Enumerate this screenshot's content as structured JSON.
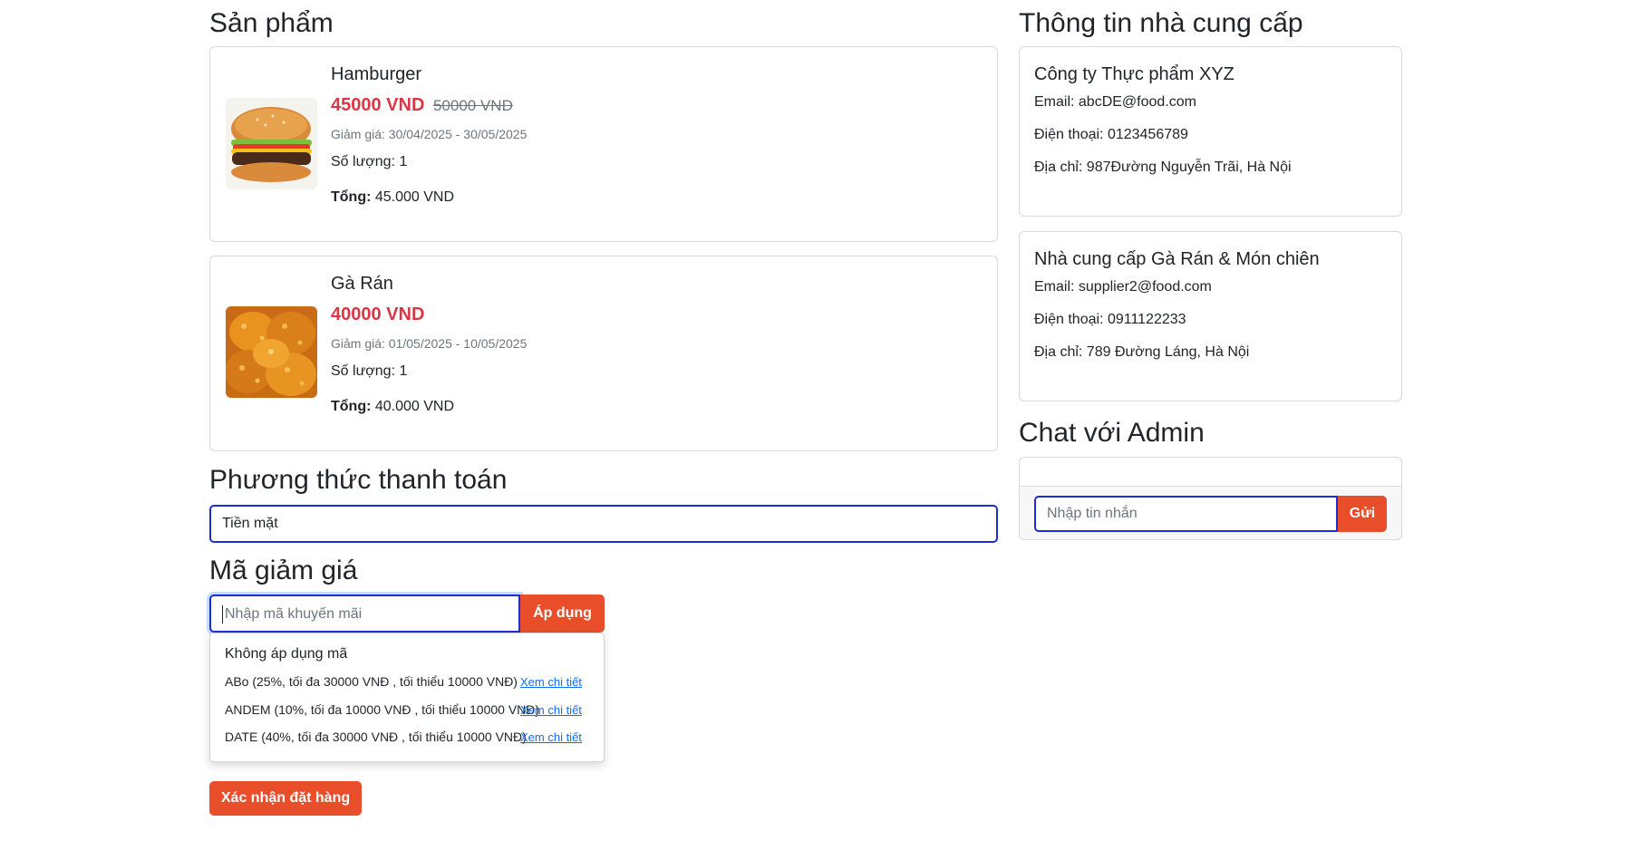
{
  "products_section": {
    "heading": "Sản phẩm",
    "items": [
      {
        "name": "Hamburger",
        "price": "45000 VND",
        "old_price": "50000 VND",
        "discount_period": "Giảm giá: 30/04/2025 - 30/05/2025",
        "quantity": "Số lượng: 1",
        "total_label": "Tổng:",
        "total_value": "45.000 VND",
        "image_icon": "hamburger-image"
      },
      {
        "name": "Gà Rán",
        "price": "40000 VND",
        "old_price": "",
        "discount_period": "Giảm giá: 01/05/2025 - 10/05/2025",
        "quantity": "Số lượng: 1",
        "total_label": "Tổng:",
        "total_value": "40.000 VND",
        "image_icon": "fried-chicken-image"
      }
    ]
  },
  "payment": {
    "heading": "Phương thức thanh toán",
    "selected": "Tiền mặt"
  },
  "coupon": {
    "heading": "Mã giảm giá",
    "placeholder": "Nhập mã khuyến mãi",
    "apply_label": "Áp dụng",
    "none_option": "Không áp dụng mã",
    "options": [
      {
        "text": "ABo (25%, tối đa 30000 VNĐ , tối thiểu 10000 VNĐ)",
        "link": "Xem chi tiết"
      },
      {
        "text": "ANDEM (10%, tối đa 10000 VNĐ , tối thiểu 10000 VNĐ)",
        "link": "Xem chi tiết"
      },
      {
        "text": "DATE (40%, tối đa 30000 VNĐ , tối thiểu 10000 VNĐ)",
        "link": "Xem chi tiết"
      }
    ]
  },
  "confirm_label": "Xác nhận đặt hàng",
  "suppliers_section": {
    "heading": "Thông tin nhà cung cấp",
    "items": [
      {
        "name": "Công ty Thực phẩm XYZ",
        "email": "Email: abcDE@food.com",
        "phone": "Điện thoại: 0123456789",
        "address": "Địa chỉ: 987Đường Nguyễn Trãi, Hà Nội"
      },
      {
        "name": "Nhà cung cấp Gà Rán & Món chiên",
        "email": "Email: supplier2@food.com",
        "phone": "Điện thoại: 0911122233",
        "address": "Địa chỉ: 789 Đường Láng, Hà Nội"
      }
    ]
  },
  "chat": {
    "heading": "Chat với Admin",
    "placeholder": "Nhập tin nhắn",
    "send_label": "Gửi"
  },
  "colors": {
    "accent": "#e94e2b",
    "price_red": "#dc3545",
    "focus_border": "#1f2dd6",
    "link_blue": "#0d6efd"
  }
}
